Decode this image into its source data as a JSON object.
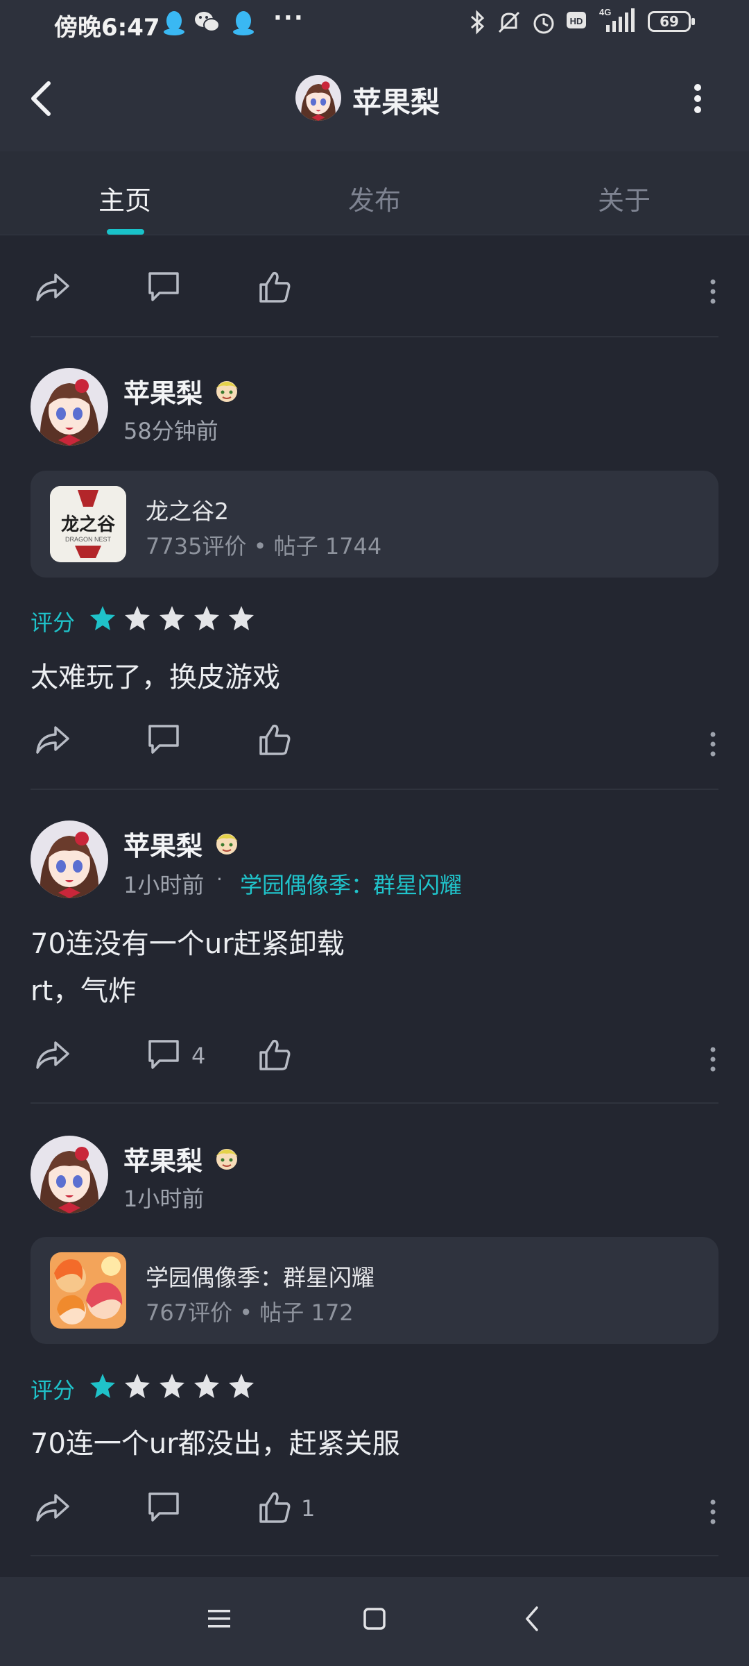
{
  "status_bar": {
    "time": "傍晚6:47",
    "battery": "69",
    "network": "4G"
  },
  "header": {
    "title": "苹果梨"
  },
  "tabs": [
    {
      "label": "主页"
    },
    {
      "label": "发布"
    },
    {
      "label": "关于"
    }
  ],
  "posts": [
    {
      "author": "苹果梨",
      "time": "58分钟前",
      "game_card": {
        "title": "龙之谷2",
        "stats": "7735评价 • 帖子 1744",
        "icon_text": "龙之谷",
        "icon_sub": "DRAGON NEST"
      },
      "rating_label": "评分",
      "rating": 1,
      "rating_max": 5,
      "text": "太难玩了，换皮游戏"
    },
    {
      "author": "苹果梨",
      "time": "1小时前",
      "separator": "·",
      "game": "学园偶像季：群星闪耀",
      "text_lines": [
        "70连没有一个ur赶紧卸载",
        "rt，气炸"
      ],
      "comment_count": "4"
    },
    {
      "author": "苹果梨",
      "time": "1小时前",
      "game_card": {
        "title": "学园偶像季：群星闪耀",
        "stats": "767评价 • 帖子 172"
      },
      "rating_label": "评分",
      "rating": 1,
      "rating_max": 5,
      "text": "70连一个ur都没出，赶紧关服",
      "like_count": "1"
    }
  ],
  "colors": {
    "accent": "#1fc2c9",
    "background": "#232630",
    "header": "#2d313c",
    "card": "#2f333e"
  }
}
